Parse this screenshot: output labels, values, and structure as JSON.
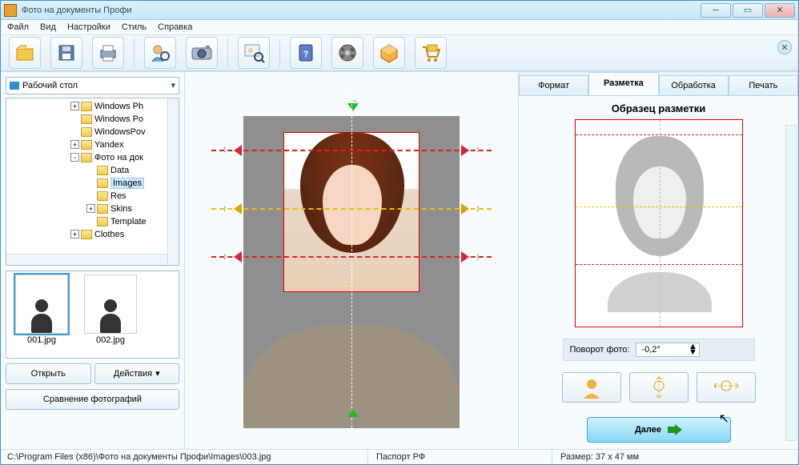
{
  "window": {
    "title": "Фото на документы Профи"
  },
  "menu": {
    "items": [
      "Файл",
      "Вид",
      "Настройки",
      "Стиль",
      "Справка"
    ]
  },
  "toolbar": {
    "icons": [
      "folder-new",
      "save",
      "print",
      "browse-user",
      "camera",
      "search-photo",
      "help-book",
      "video",
      "package",
      "cart"
    ]
  },
  "left": {
    "dropdown": "Рабочий стол",
    "tree": [
      {
        "indent": 80,
        "exp": "+",
        "label": "Windows Ph"
      },
      {
        "indent": 80,
        "exp": "",
        "label": "Windows Po"
      },
      {
        "indent": 80,
        "exp": "",
        "label": "WindowsPov"
      },
      {
        "indent": 80,
        "exp": "+",
        "label": "Yandex"
      },
      {
        "indent": 80,
        "exp": "-",
        "label": "Фото на док"
      },
      {
        "indent": 100,
        "exp": "",
        "label": "Data"
      },
      {
        "indent": 100,
        "exp": "",
        "label": "Images",
        "sel": true
      },
      {
        "indent": 100,
        "exp": "",
        "label": "Res"
      },
      {
        "indent": 100,
        "exp": "+",
        "label": "Skins"
      },
      {
        "indent": 100,
        "exp": "",
        "label": "Template"
      },
      {
        "indent": 80,
        "exp": "+",
        "label": "Clothes"
      }
    ],
    "thumbs": [
      {
        "name": "001.jpg",
        "sel": true
      },
      {
        "name": "002.jpg"
      }
    ],
    "open_btn": "Открыть",
    "actions_btn": "Действия",
    "compare_btn": "Сравнение фотографий"
  },
  "right": {
    "tabs": [
      "Формат",
      "Разметка",
      "Обработка",
      "Печать"
    ],
    "active_tab": 1,
    "sample_title": "Образец разметки",
    "rotate_label": "Поворот фото:",
    "rotate_value": "-0,2°",
    "next_btn": "Далее"
  },
  "status": {
    "path": "C:\\Program Files (x86)\\Фото на документы Профи\\Images\\003.jpg",
    "format": "Паспорт РФ",
    "size": "Размер: 37 x 47 мм"
  }
}
